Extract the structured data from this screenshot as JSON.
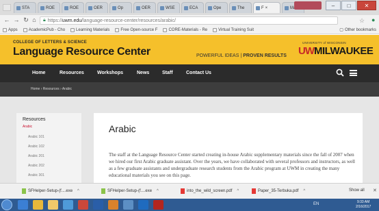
{
  "browser": {
    "tabs": [
      {
        "label": "STA"
      },
      {
        "label": "ROE"
      },
      {
        "label": "ROE"
      },
      {
        "label": "OER"
      },
      {
        "label": "Op"
      },
      {
        "label": "OER"
      },
      {
        "label": "WSE"
      },
      {
        "label": "ECA"
      },
      {
        "label": "Ope"
      },
      {
        "label": "The"
      },
      {
        "label": "F"
      },
      {
        "label": "Mai"
      }
    ],
    "user_chip": "",
    "url_scheme": "https://",
    "url_host": "uwm.edu",
    "url_path": "/language-resource-center/resources/arabic/",
    "bookmarks": [
      {
        "label": "Apps"
      },
      {
        "label": "AcademicPub - Cho"
      },
      {
        "label": "Learning Materials"
      },
      {
        "label": "Free Open-source F"
      },
      {
        "label": "CORE-Materials - Re"
      },
      {
        "label": "Virtual Training Suit"
      }
    ],
    "other_bookmarks": "Other bookmarks"
  },
  "site": {
    "college": "COLLEGE OF LETTERS & SCIENCE",
    "center_title": "Language Resource Center",
    "tagline_a": "POWERFUL IDEAS",
    "tagline_sep": "|",
    "tagline_b": "PROVEN RESULTS",
    "university_small": "UNIVERSITY of WISCONSIN",
    "logo_uw": "UW",
    "logo_milwaukee": "MILWAUKEE",
    "nav": [
      "Home",
      "Resources",
      "Workshops",
      "News",
      "Staff",
      "Contact Us"
    ],
    "breadcrumb": "Home › Resources › Arabic"
  },
  "sidebar": {
    "heading": "Resources",
    "active": "Arabic",
    "items": [
      "Arabic 101",
      "Arabic 102",
      "Arabic 201",
      "Arabic 202",
      "Arabic 301"
    ]
  },
  "main": {
    "title": "Arabic",
    "body": "The staff at the Language Resource Center started creating in-house Arabic supplementary materials since the fall of 2007 when we hired our first Arabic graduate assistant. Over the years, we have collaborated with several professors and instructors, as well as a few graduate assistants and undergraduate research students from the Arabic program at UWM in creating the many educational materials you see on this page."
  },
  "downloads": {
    "items": [
      {
        "label": "SFHelper-Setup-(f....exe"
      },
      {
        "label": "SFHelper-Setup-(f....exe"
      },
      {
        "label": "into_the_wild_screen.pdf"
      },
      {
        "label": "Paper_35-Terbuka.pdf"
      }
    ],
    "show_all": "Show all"
  },
  "taskbar": {
    "tray": "EN",
    "time": "9:33 AM",
    "date": "2/16/2017"
  },
  "colors": {
    "brand_yellow": "#f5c02b",
    "nav_dark": "#2b2b2b",
    "accent_red": "#c8102e"
  }
}
